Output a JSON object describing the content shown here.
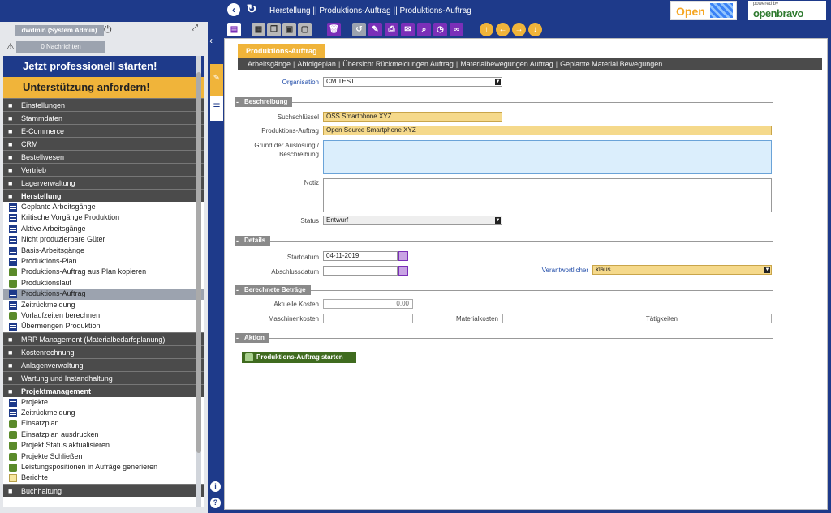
{
  "topbar": {
    "back_icon": "back-icon",
    "refresh_icon": "refresh-icon",
    "breadcrumb": "Herstellung || Produktions-Auftrag  ||  Produktions-Auftrag",
    "logo_open": "Open",
    "powered_by": "powered by",
    "logo_openbravo": "openbravo"
  },
  "user": {
    "name": "dwdmin (System Admin)",
    "messages": "0  Nachrichten"
  },
  "promo": {
    "start": "Jetzt professionell starten!",
    "support": "Unterstützung anfordern!"
  },
  "menu": [
    {
      "label": "Einstellungen",
      "icon": "gear-icon"
    },
    {
      "label": "Stammdaten",
      "icon": "list-icon"
    },
    {
      "label": "E-Commerce",
      "icon": "monitor-icon"
    },
    {
      "label": "CRM",
      "icon": "chat-icon"
    },
    {
      "label": "Bestellwesen",
      "icon": "cart-icon"
    },
    {
      "label": "Vertrieb",
      "icon": "truck-icon"
    },
    {
      "label": "Lagerverwaltung",
      "icon": "forklift-icon"
    },
    {
      "label": "Herstellung",
      "icon": "hammer-icon"
    }
  ],
  "herstellung_items": [
    {
      "label": "Geplante Arbeitsgänge",
      "type": "window"
    },
    {
      "label": "Kritische Vorgänge Produktion",
      "type": "window"
    },
    {
      "label": "Aktive Arbeitsgänge",
      "type": "window"
    },
    {
      "label": "Nicht produzierbare Güter",
      "type": "window"
    },
    {
      "label": "Basis-Arbeitsgänge",
      "type": "window"
    },
    {
      "label": "Produktions-Plan",
      "type": "window"
    },
    {
      "label": "Produktions-Auftrag aus Plan kopieren",
      "type": "process"
    },
    {
      "label": "Produktionslauf",
      "type": "process"
    },
    {
      "label": "Produktions-Auftrag",
      "type": "window"
    },
    {
      "label": "Zeitrückmeldung",
      "type": "window"
    },
    {
      "label": "Vorlaufzeiten berechnen",
      "type": "process"
    },
    {
      "label": "Übermengen Produktion",
      "type": "window"
    }
  ],
  "menu2": [
    {
      "label": "MRP Management (Materialbedarfsplanung)",
      "icon": "hierarchy-icon"
    },
    {
      "label": "Kostenrechnung",
      "icon": "chart-icon"
    },
    {
      "label": "Anlagenverwaltung",
      "icon": "link-icon"
    },
    {
      "label": "Wartung und Instandhaltung",
      "icon": "shield-icon"
    },
    {
      "label": "Projektmanagement",
      "icon": "project-icon"
    }
  ],
  "projekt_items": [
    {
      "label": "Projekte",
      "type": "window"
    },
    {
      "label": "Zeitrückmeldung",
      "type": "window"
    },
    {
      "label": "Einsatzplan",
      "type": "process"
    },
    {
      "label": "Einsatzplan ausdrucken",
      "type": "process"
    },
    {
      "label": "Projekt Status aktualisieren",
      "type": "process"
    },
    {
      "label": "Projekte Schließen",
      "type": "process"
    },
    {
      "label": "Leistungspositionen in Aufräge generieren",
      "type": "process"
    },
    {
      "label": "Berichte",
      "type": "report"
    }
  ],
  "menu3": [
    {
      "label": "Buchhaltung",
      "icon": "money-icon"
    }
  ],
  "content": {
    "tab": "Produktions-Auftrag",
    "links": [
      "Arbeitsgänge",
      "Abfolgeplan",
      "Übersicht Rückmeldungen Auftrag",
      "Materialbewegungen Auftrag",
      "Geplante Material Bewegungen"
    ],
    "organisation_label": "Organisation",
    "organisation_value": "CM TEST",
    "sec_beschreibung": "Beschreibung",
    "suchschluessel_label": "Suchschlüssel",
    "suchschluessel_value": "OSS Smartphone XYZ",
    "auftrag_label": "Produktions-Auftrag",
    "auftrag_value": "Open Source Smartphone XYZ",
    "grund_label": "Grund der Auslösung / Beschreibung",
    "notiz_label": "Notiz",
    "status_label": "Status",
    "status_value": "Entwurf",
    "sec_details": "Details",
    "startdatum_label": "Startdatum",
    "startdatum_value": "04-11-2019",
    "abschluss_label": "Abschlussdatum",
    "verantwortlicher_label": "Verantwortlicher",
    "verantwortlicher_value": "klaus",
    "sec_betraege": "Berechnete Beträge",
    "kosten_label": "Aktuelle Kosten",
    "kosten_value": "0,00",
    "maschinen_label": "Maschinenkosten",
    "material_label": "Materialkosten",
    "taetigkeiten_label": "Tätigkeiten",
    "sec_aktion": "Aktion",
    "start_button": "Produktions-Auftrag starten"
  },
  "colors": {
    "primary": "#1e3a8a",
    "accent": "#f0b43a",
    "toolbar_icon": "#7b2fb8",
    "action_green": "#3f6b1f"
  }
}
